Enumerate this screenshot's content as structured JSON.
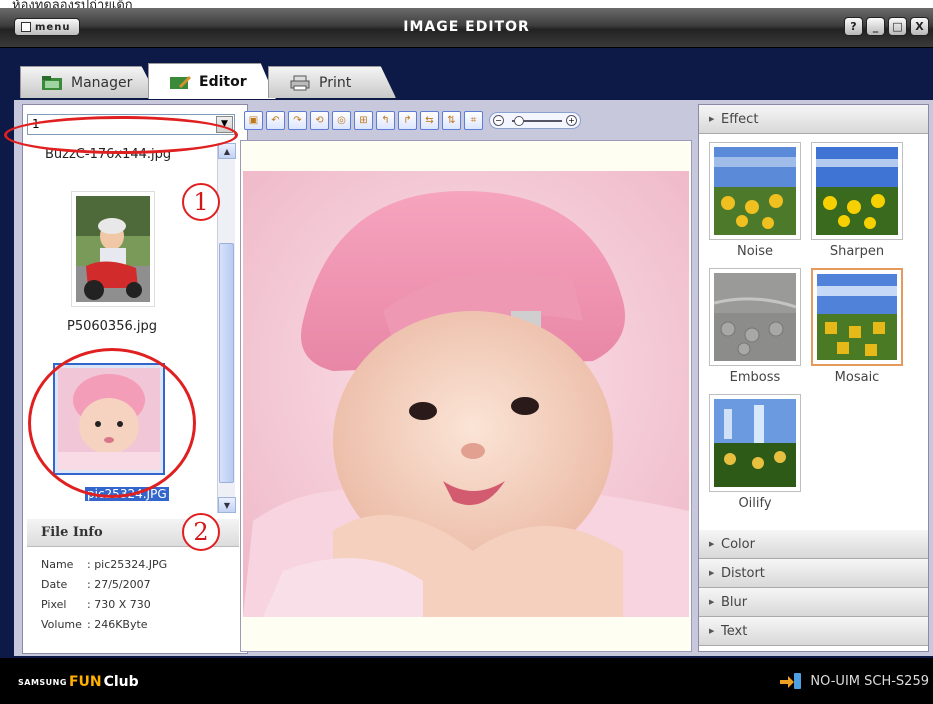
{
  "top_caption": "ห้องทดลองรูปถ่ายเด็ก",
  "titlebar": {
    "menu_label": "menu",
    "title": "IMAGE EDITOR",
    "buttons": [
      "?",
      "_",
      "□",
      "X"
    ]
  },
  "tabs": [
    {
      "label": "Manager",
      "active": false,
      "icon": "folder-icon"
    },
    {
      "label": "Editor",
      "active": true,
      "icon": "pencil-icon"
    },
    {
      "label": "Print",
      "active": false,
      "icon": "printer-icon"
    }
  ],
  "combo": {
    "value": "1"
  },
  "thumbnails": [
    {
      "label": "BuzzC-176x144.jpg"
    },
    {
      "label": "P5060356.jpg"
    },
    {
      "label": "pic25324.JPG",
      "selected": true
    }
  ],
  "file_info": {
    "title": "File Info",
    "rows": [
      {
        "key": "Name",
        "value": ": pic25324.JPG"
      },
      {
        "key": "Date",
        "value": ": 27/5/2007"
      },
      {
        "key": "Pixel",
        "value": ": 730 X 730"
      },
      {
        "key": "Volume",
        "value": ": 246KByte"
      }
    ]
  },
  "toolbar": {
    "buttons": [
      "save-icon",
      "undo-icon",
      "redo-icon",
      "reset-icon",
      "rotate-icon",
      "fit-icon",
      "rotate-left-icon",
      "rotate-right-icon",
      "flip-horizontal-icon",
      "flip-vertical-icon",
      "crop-icon"
    ],
    "zoom_level": 0.1
  },
  "right_panel": {
    "sections": [
      {
        "label": "Effect",
        "expanded": true
      },
      {
        "label": "Color"
      },
      {
        "label": "Distort"
      },
      {
        "label": "Blur"
      },
      {
        "label": "Text"
      }
    ],
    "effects": [
      {
        "label": "Noise"
      },
      {
        "label": "Sharpen"
      },
      {
        "label": "Emboss"
      },
      {
        "label": "Mosaic",
        "selected": true
      },
      {
        "label": "Oilify"
      }
    ]
  },
  "statusbar": {
    "brand_prefix": "SAMSUNG",
    "brand_fun": "FUN",
    "brand_club": "Club",
    "status": "NO-UIM  SCH-S259"
  },
  "annotations": {
    "one": "1",
    "two": "2"
  },
  "colors": {
    "frame": "#0d1a48",
    "accent": "#e02020",
    "selection": "#3366cc"
  }
}
